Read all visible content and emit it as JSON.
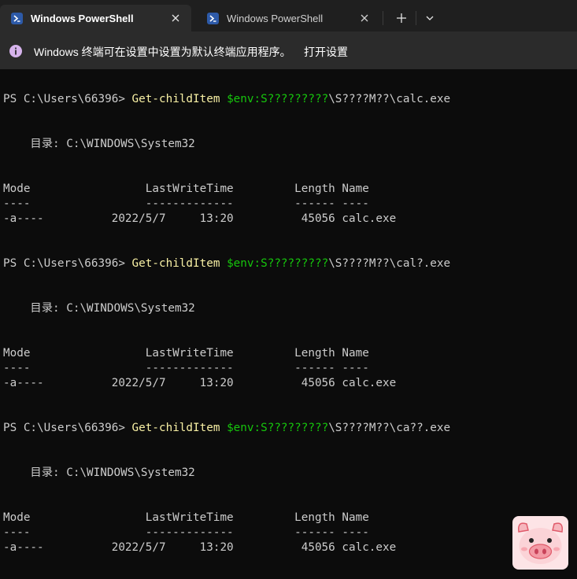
{
  "tabs": [
    {
      "title": "Windows PowerShell",
      "active": true
    },
    {
      "title": "Windows PowerShell",
      "active": false
    }
  ],
  "infobar": {
    "message": "Windows 终端可在设置中设置为默认终端应用程序。",
    "link": "打开设置"
  },
  "colors": {
    "background": "#0c0c0c",
    "tabbar": "#1f1f1f",
    "active_tab": "#2b2b2b",
    "command": "#f9f1a5",
    "variable": "#16c60c",
    "text": "#cccccc"
  },
  "terminal": {
    "blocks": [
      {
        "prompt": "PS C:\\Users\\66396> ",
        "command": "Get-childItem",
        "variable": "$env:S?????????",
        "arg_rest": "\\S????M??\\calc.exe",
        "directory": "    目录: C:\\WINDOWS\\System32",
        "header": "Mode                 LastWriteTime         Length Name",
        "divider": "----                 -------------         ------ ----",
        "row": "-a----          2022/5/7     13:20          45056 calc.exe"
      },
      {
        "prompt": "PS C:\\Users\\66396> ",
        "command": "Get-childItem",
        "variable": "$env:S?????????",
        "arg_rest": "\\S????M??\\cal?.exe",
        "directory": "    目录: C:\\WINDOWS\\System32",
        "header": "Mode                 LastWriteTime         Length Name",
        "divider": "----                 -------------         ------ ----",
        "row": "-a----          2022/5/7     13:20          45056 calc.exe"
      },
      {
        "prompt": "PS C:\\Users\\66396> ",
        "command": "Get-childItem",
        "variable": "$env:S?????????",
        "arg_rest": "\\S????M??\\ca??.exe",
        "directory": "    目录: C:\\WINDOWS\\System32",
        "header": "Mode                 LastWriteTime         Length Name",
        "divider": "----                 -------------         ------ ----",
        "row": "-a----          2022/5/7     13:20          45056 calc.exe"
      }
    ]
  },
  "icons": {
    "tab_icon": "powershell-icon",
    "close": "close-icon",
    "new_tab": "plus-icon",
    "dropdown": "chevron-down-icon",
    "info": "info-icon",
    "sticker": "pig-sticker"
  }
}
